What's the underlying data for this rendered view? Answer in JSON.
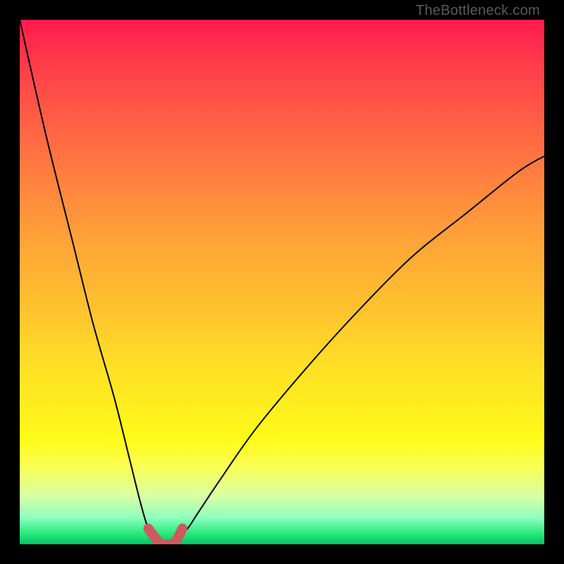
{
  "attribution": "TheBottleneck.com",
  "chart_data": {
    "type": "line",
    "title": "",
    "xlabel": "",
    "ylabel": "",
    "xlim": [
      0,
      100
    ],
    "ylim": [
      0,
      100
    ],
    "series": [
      {
        "name": "bottleneck-curve",
        "x": [
          0,
          5,
          10,
          14,
          18,
          21,
          23,
          24.5,
          26,
          27,
          28,
          29,
          30,
          32,
          34,
          38,
          45,
          55,
          65,
          75,
          85,
          95,
          100
        ],
        "values": [
          100,
          78,
          58,
          42,
          28,
          16,
          8,
          3,
          1,
          0,
          0,
          0,
          1,
          3,
          6,
          12,
          22,
          34,
          45,
          55,
          63,
          71,
          74
        ]
      }
    ],
    "highlight": {
      "name": "valley-marker",
      "x": [
        24.5,
        26,
        27,
        28,
        29,
        30,
        31
      ],
      "values": [
        3,
        1,
        0,
        0,
        0,
        1,
        3
      ],
      "color": "#cc5a5f",
      "stroke_width": 14
    }
  }
}
